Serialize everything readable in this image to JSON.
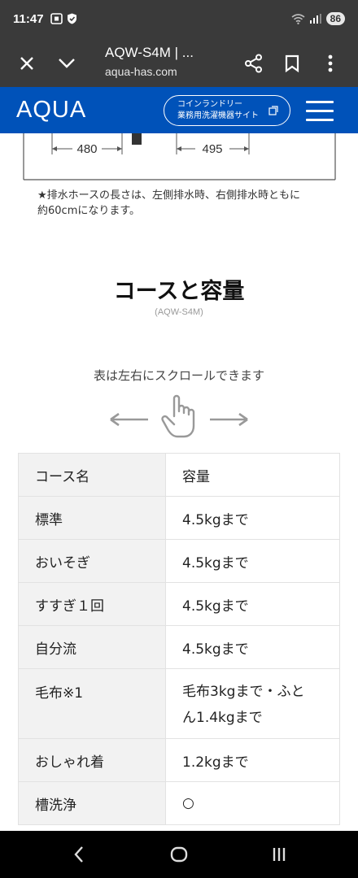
{
  "status_bar": {
    "time": "11:47",
    "battery": "86"
  },
  "browser": {
    "page_title": "AQW-S4M | ...",
    "url": "aqua-has.com",
    "icons": [
      "close-icon",
      "chevron-down-icon",
      "share-icon",
      "bookmark-icon",
      "more-vert-icon"
    ]
  },
  "site_header": {
    "logo": "AQUA",
    "coin_button_line1": "コインランドリー",
    "coin_button_line2": "業務用洗濯機器サイト",
    "menu_icon": "hamburger-icon",
    "colors": {
      "brand_blue": "#0052b9"
    }
  },
  "diagram": {
    "dim_left": "480",
    "dim_right": "495"
  },
  "note": {
    "line1": "★排水ホースの長さは、左側排水時、右側排水時ともに",
    "line2": "約60cmになります。"
  },
  "section": {
    "title": "コースと容量",
    "model": "(AQW-S4M)",
    "scroll_hint": "表は左右にスクロールできます"
  },
  "table": {
    "headers": [
      "コース名",
      "容量"
    ],
    "rows": [
      {
        "name": "標準",
        "value": "4.5kgまで"
      },
      {
        "name": "おいそぎ",
        "value": "4.5kgまで"
      },
      {
        "name": "すすぎ１回",
        "value": "4.5kgまで"
      },
      {
        "name": "自分流",
        "value": "4.5kgまで"
      },
      {
        "name": "毛布※1",
        "value_line1": "毛布3kgまで・ふと",
        "value_line2": "ん1.4kgまで"
      },
      {
        "name": "おしゃれ着",
        "value": "1.2kgまで"
      },
      {
        "name": "槽洗浄",
        "value": "○"
      }
    ]
  },
  "nav_bar": {
    "icons": [
      "back-icon",
      "home-icon",
      "recents-icon"
    ]
  }
}
